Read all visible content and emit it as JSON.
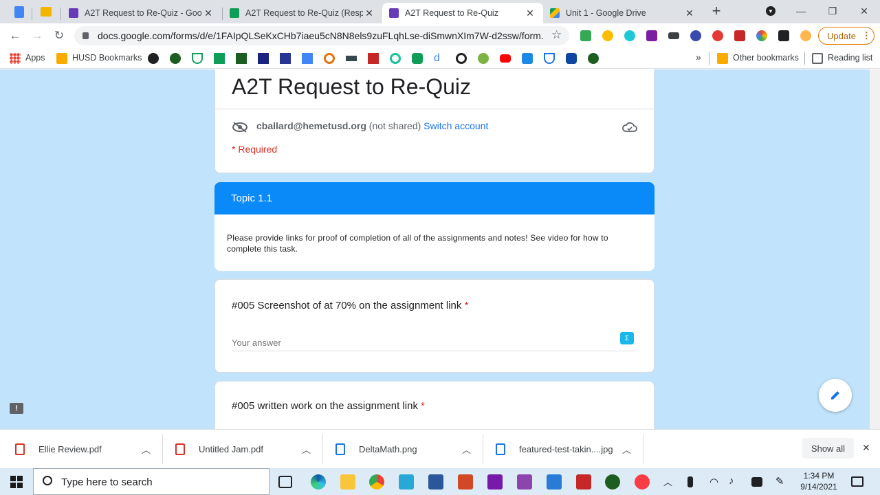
{
  "browser": {
    "tabs": [
      {
        "title": "A2T Request to Re-Quiz - Googl",
        "color": "#673ab7"
      },
      {
        "title": "A2T Request to Re-Quiz (Respor",
        "color": "#0f9d58"
      },
      {
        "title": "A2T Request to Re-Quiz",
        "color": "#673ab7",
        "active": true
      },
      {
        "title": "Unit 1 - Google Drive",
        "color": "#fbbc04"
      }
    ],
    "url": "docs.google.com/forms/d/e/1FAIpQLSeKxCHb7iaeu5cN8N8els9zuFLqhLse-diSmwnXIm7W-d2ssw/form...",
    "update_label": "Update",
    "bookmarks": {
      "apps": "Apps",
      "husd": "HUSD Bookmarks",
      "overflow": "»",
      "other": "Other bookmarks",
      "reading_list": "Reading list"
    }
  },
  "form": {
    "title": "A2T Request to Re-Quiz",
    "account_email": "cballard@hemetusd.org",
    "not_shared": "(not shared)",
    "switch_account": "Switch account",
    "required_note": "* Required",
    "section_title": "Topic 1.1",
    "section_desc": "Please provide links for proof of completion of all of the assignments and notes! See video for how to complete this task.",
    "q1": {
      "label": "#005 Screenshot of at 70% on the assignment link",
      "required_mark": "*",
      "placeholder": "Your answer"
    },
    "q2": {
      "label": "#005 written work on the assignment link",
      "required_mark": "*"
    },
    "accent_color": "#0a89f8"
  },
  "downloads": {
    "items": [
      {
        "name": "Ellie Review.pdf"
      },
      {
        "name": "Untitled Jam.pdf"
      },
      {
        "name": "DeltaMath.png"
      },
      {
        "name": "featured-test-takin....jpg"
      }
    ],
    "show_all": "Show all"
  },
  "taskbar": {
    "search_placeholder": "Type here to search",
    "time": "1:34 PM",
    "date": "9/14/2021"
  }
}
